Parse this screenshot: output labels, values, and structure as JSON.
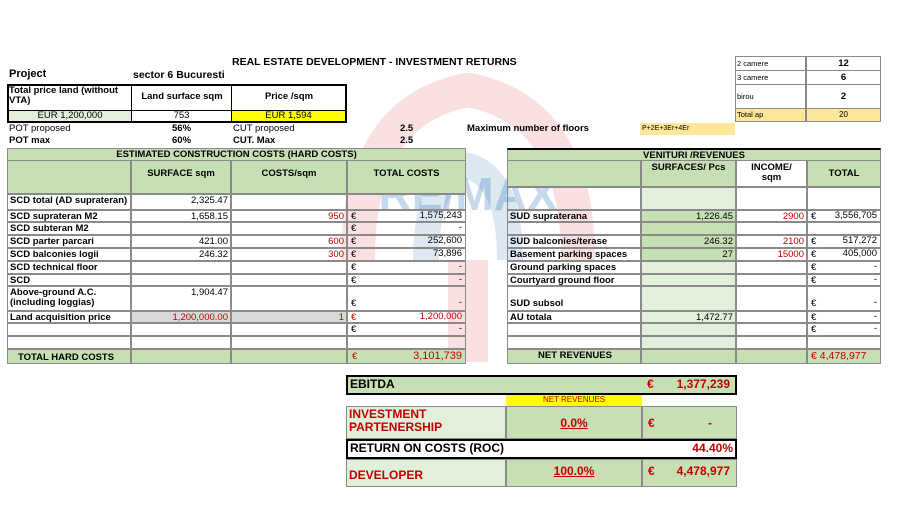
{
  "title": "REAL ESTATE DEVELOPMENT - INVESTMENT RETURNS",
  "watermark": "RE/MAX",
  "project": {
    "label": "Project",
    "value": "sector 6 Bucuresti"
  },
  "land": {
    "price_label": "Total price land (without VTA)",
    "surface_label": "Land surface sqm",
    "price_sqm_label": "Price /sqm",
    "price_value": "EUR 1,200,000",
    "surface_value": "753",
    "price_sqm_value": "EUR 1,594"
  },
  "rooms": [
    {
      "label": "2 camere",
      "value": "12"
    },
    {
      "label": "3 camere",
      "value": "6"
    },
    {
      "label": "birou",
      "value": "2"
    },
    {
      "label": "Total ap",
      "value": "20"
    }
  ],
  "params": {
    "pot_proposed_label": "POT proposed",
    "pot_proposed_value": "56%",
    "pot_max_label": "POT max",
    "pot_max_value": "60%",
    "cut_proposed_label": "CUT proposed",
    "cut_proposed_value": "2.5",
    "cut_max_label": "CUT. Max",
    "cut_max_value": "2.5",
    "max_floors_label": "Maximum number of floors",
    "max_floors_value": "P+2E+3Er+4Er"
  },
  "costs": {
    "section_title": "ESTIMATED CONSTRUCTION COSTS  (HARD COSTS)",
    "headers": [
      "SURFACE sqm",
      "COSTS/sqm",
      "TOTAL COSTS"
    ],
    "currency": "€",
    "rows": [
      {
        "label": "SCD total (AD suprateran)",
        "surface": "2,325.47",
        "cost": "",
        "cur": "",
        "total": ""
      },
      {
        "label": "SCD suprateran  M2",
        "surface": "1,658.15",
        "cost": "950",
        "cur": "€",
        "total": "1,575,243"
      },
      {
        "label": "SCD subteran M2",
        "surface": "",
        "cost": "",
        "cur": "€",
        "total": "-"
      },
      {
        "label": "SCD parter parcari",
        "surface": "421.00",
        "cost": "600",
        "cur": "€",
        "total": "252,600"
      },
      {
        "label": "SCD balconies logii",
        "surface": "246.32",
        "cost": "300",
        "cur": "€",
        "total": "73,896"
      },
      {
        "label": "SCD technical floor",
        "surface": "",
        "cost": "",
        "cur": "€",
        "total": "-"
      },
      {
        "label": "SCD",
        "surface": "",
        "cost": "",
        "cur": "€",
        "total": "-"
      },
      {
        "label": "Above-ground A.C. (including loggias)",
        "surface": "1,904.47",
        "cost": "",
        "cur": "€",
        "total": "-"
      },
      {
        "label": "Land acquisition price",
        "surface": "1,200,000.00",
        "cost": "1",
        "cur": "€",
        "total": "1,200,000"
      },
      {
        "label": "",
        "surface": "",
        "cost": "",
        "cur": "€",
        "total": "-"
      },
      {
        "label": "",
        "surface": "",
        "cost": "",
        "cur": "",
        "total": ""
      }
    ],
    "total_label": "TOTAL HARD COSTS",
    "total_cur": "€",
    "total_value": "3,101,739"
  },
  "revenues": {
    "section_title": "VENITURI /REVENUES",
    "headers": [
      "SURFACES/ Pcs",
      "INCOME/ sqm",
      "TOTAL"
    ],
    "rows": [
      {
        "label": "",
        "surface": "",
        "income": "",
        "cur": "",
        "total": ""
      },
      {
        "label": "SUD supraterana",
        "surface": "1,226.45",
        "income": "2900",
        "cur": "€",
        "total": "3,556,705"
      },
      {
        "label": "",
        "surface": "",
        "income": "",
        "cur": "",
        "total": ""
      },
      {
        "label": "SUD balconies/terase",
        "surface": "246.32",
        "income": "2100",
        "cur": "€",
        "total": "517,272"
      },
      {
        "label": "Basement parking spaces",
        "surface": "27",
        "income": "15000",
        "cur": "€",
        "total": "405,000"
      },
      {
        "label": "Ground parking spaces",
        "surface": "",
        "income": "",
        "cur": "€",
        "total": "-"
      },
      {
        "label": "Courtyard ground floor",
        "surface": "",
        "income": "",
        "cur": "€",
        "total": "-"
      },
      {
        "label": "SUD subsol",
        "surface": "",
        "income": "",
        "cur": "€",
        "total": "-"
      },
      {
        "label": "AU totala",
        "surface": "1,472.77",
        "income": "",
        "cur": "€",
        "total": "-"
      },
      {
        "label": "",
        "surface": "",
        "income": "",
        "cur": "€",
        "total": "-"
      },
      {
        "label": "",
        "surface": "",
        "income": "",
        "cur": "",
        "total": ""
      }
    ],
    "net_label": "NET REVENUES",
    "net_value": "€ 4,478,977"
  },
  "summary": {
    "ebitda_label": "EBITDA",
    "ebitda_cur": "€",
    "ebitda_value": "1,377,239",
    "net_rev_note": "NET REVENUES",
    "inv_label": "INVESTMENT PARTENERSHIP",
    "inv_pct": "0.0%",
    "inv_cur": "€",
    "inv_value": "-",
    "roc_label": "RETURN ON COSTS (ROC)",
    "roc_value": "44.40%",
    "dev_label": "DEVELOPER",
    "dev_pct": "100.0%",
    "dev_cur": "€",
    "dev_value": "4,478,977"
  }
}
